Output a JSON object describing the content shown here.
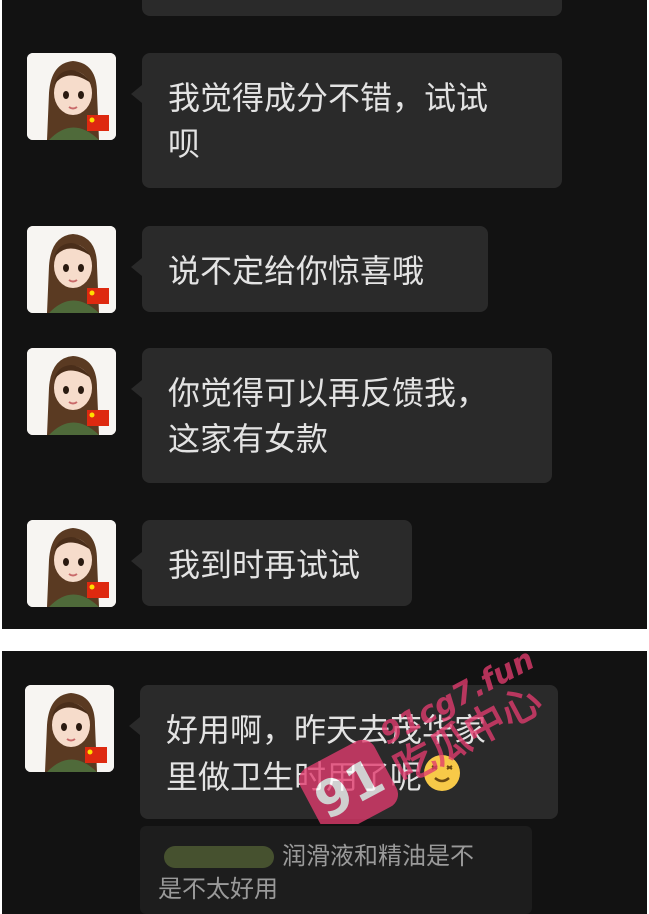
{
  "messages": [
    {
      "text": "我觉得成分不错，试试\n呗"
    },
    {
      "text": "说不定给你惊喜哦"
    },
    {
      "text": "你觉得可以再反馈我，\n这家有女款"
    },
    {
      "text": "我到时再试试"
    },
    {
      "text": "好用啊，昨天去茂华家\n里做卫生时用了呢",
      "emoji": "smiling-face-emoji"
    }
  ],
  "quoted_message": {
    "text": "润滑液和精油是不\n是不太好用"
  },
  "watermark": {
    "badge": "91",
    "url": "91cg7.fun",
    "name": "吃瓜中心",
    "color": "#e23b6e"
  },
  "icons": [
    "avatar-cartoon-girl",
    "china-flag-icon",
    "smiling-face-emoji"
  ]
}
